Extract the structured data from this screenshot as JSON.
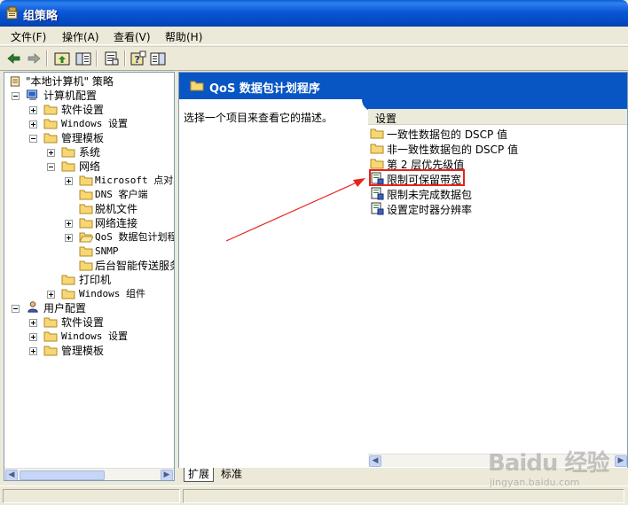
{
  "window": {
    "title": "组策略",
    "icon": "group-policy-icon"
  },
  "menubar": [
    {
      "label": "文件(F)"
    },
    {
      "label": "操作(A)"
    },
    {
      "label": "查看(V)"
    },
    {
      "label": "帮助(H)"
    }
  ],
  "toolbar": {
    "buttons": [
      "back-arrow-icon",
      "forward-arrow-icon",
      "up-folder-icon",
      "show-hide-tree-icon",
      "export-list-icon",
      "help-icon",
      "show-hide-action-pane-icon"
    ]
  },
  "tree": {
    "root": "\"本地计算机\" 策略",
    "items": [
      {
        "label": "计算机配置"
      },
      {
        "label": "软件设置"
      },
      {
        "label": "Windows 设置"
      },
      {
        "label": "管理模板"
      },
      {
        "label": "系统"
      },
      {
        "label": "网络"
      },
      {
        "label": "Microsoft 点对点"
      },
      {
        "label": "DNS 客户端"
      },
      {
        "label": "脱机文件"
      },
      {
        "label": "网络连接"
      },
      {
        "label": "QoS 数据包计划程序"
      },
      {
        "label": "SNMP"
      },
      {
        "label": "后台智能传送服务"
      },
      {
        "label": "打印机"
      },
      {
        "label": "Windows 组件"
      },
      {
        "label": "用户配置"
      },
      {
        "label": "软件设置"
      },
      {
        "label": "Windows 设置"
      },
      {
        "label": "管理模板"
      }
    ]
  },
  "right": {
    "header_title": "QoS 数据包计划程序",
    "description": "选择一个项目来查看它的描述。",
    "column_header": "设置",
    "items": [
      {
        "label": "一致性数据包的 DSCP 值",
        "icon": "folder-icon"
      },
      {
        "label": "非一致性数据包的 DSCP 值",
        "icon": "folder-icon"
      },
      {
        "label": "第 2 层优先级值",
        "icon": "folder-icon"
      },
      {
        "label": "限制可保留带宽",
        "icon": "policy-setting-icon"
      },
      {
        "label": "限制未完成数据包",
        "icon": "policy-setting-icon"
      },
      {
        "label": "设置定时器分辨率",
        "icon": "policy-setting-icon"
      }
    ],
    "highlighted_item": "限制可保留带宽"
  },
  "tabs": [
    {
      "label": "扩展"
    },
    {
      "label": "标准"
    }
  ],
  "watermark": {
    "logo": "Baidu 经验",
    "url": "jingyan.baidu.com"
  },
  "colors": {
    "title_bar": "#0a56d6",
    "header_blue": "#0856c4",
    "highlight_red": "#e8231b"
  }
}
